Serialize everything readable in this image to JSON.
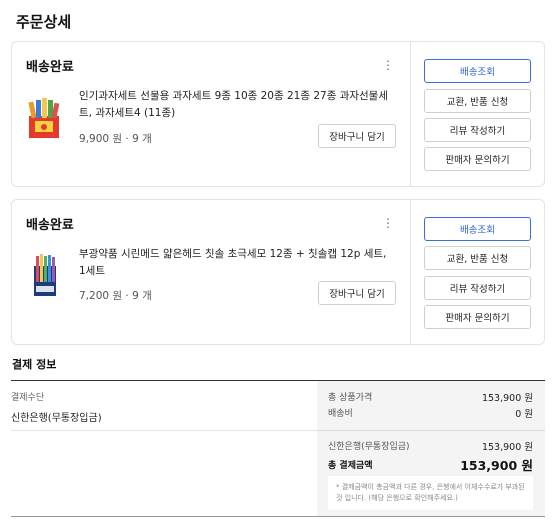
{
  "page": {
    "title": "주문상세"
  },
  "orders": [
    {
      "status": "배송완료",
      "product_name": "인기과자세트 선물용 과자세트 9종 10종 20종 21종 27종 과자선물세트, 과자세트4 (11종)",
      "price_qty": "9,900 원 · 9 개",
      "cart_label": "장바구니 담기",
      "actions": [
        "배송조회",
        "교환, 반품 신청",
        "리뷰 작성하기",
        "판매자 문의하기"
      ],
      "more_icon": "⋮"
    },
    {
      "status": "배송완료",
      "product_name": "부광약품 시린메드 얇은헤드 칫솔 초극세모 12종 + 칫솔캡 12p 세트, 1세트",
      "price_qty": "7,200 원 · 9 개",
      "cart_label": "장바구니 담기",
      "actions": [
        "배송조회",
        "교환, 반품 신청",
        "리뷰 작성하기",
        "판매자 문의하기"
      ],
      "more_icon": "⋮"
    }
  ],
  "payment": {
    "title": "결제 정보",
    "method_label": "결제수단",
    "method_value": "신한은행(무통장입금)",
    "rows": [
      {
        "label": "총 상품가격",
        "value": "153,900 원"
      },
      {
        "label": "배송비",
        "value": "0 원"
      },
      {
        "label": "신한은행(무통장입금)",
        "value": "153,900 원"
      }
    ],
    "total_label": "총 결제금액",
    "total_value": "153,900 원",
    "notice": "* 결제금액이 총금액과 다른 경우, 은행에서 이체수수료가 부과된 것 입니다. (해당 은행으로 확인해주세요.)"
  },
  "colors": {
    "accent": "#2f63d3",
    "border": "#e4e4e4",
    "summary_bg": "#f4f4f4"
  }
}
